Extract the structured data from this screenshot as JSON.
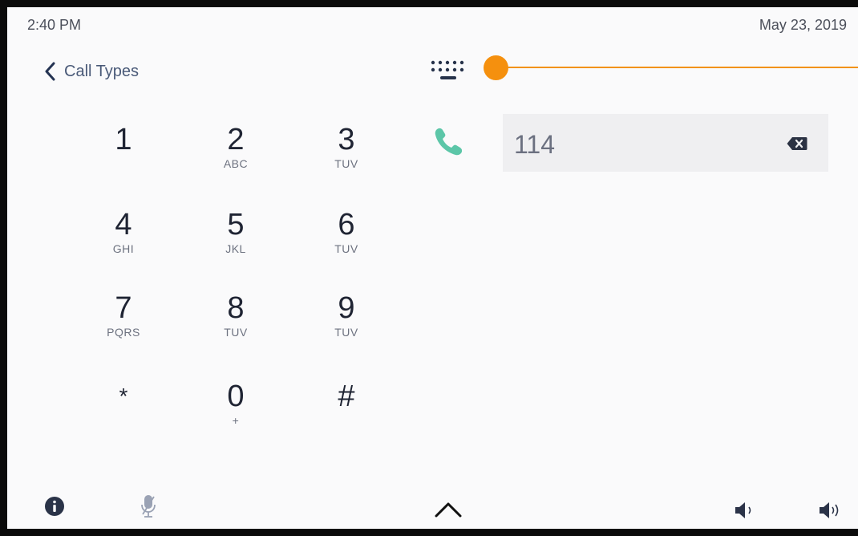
{
  "status": {
    "time": "2:40 PM",
    "date": "May 23, 2019"
  },
  "nav": {
    "back_label": "Call Types"
  },
  "keypad": [
    {
      "digit": "1",
      "letters": ""
    },
    {
      "digit": "2",
      "letters": "ABC"
    },
    {
      "digit": "3",
      "letters": "TUV"
    },
    {
      "digit": "4",
      "letters": "GHI"
    },
    {
      "digit": "5",
      "letters": "JKL"
    },
    {
      "digit": "6",
      "letters": "TUV"
    },
    {
      "digit": "7",
      "letters": "PQRS"
    },
    {
      "digit": "8",
      "letters": "TUV"
    },
    {
      "digit": "9",
      "letters": "TUV"
    },
    {
      "digit": "*",
      "letters": ""
    },
    {
      "digit": "0",
      "letters": "+"
    },
    {
      "digit": "#",
      "letters": ""
    }
  ],
  "dial": {
    "number": "114"
  },
  "slider": {
    "value": 0
  },
  "colors": {
    "accent": "#f5900e",
    "call": "#5cc6a8",
    "text": "#1f2433",
    "field": "#efeff1"
  },
  "icons": [
    "back-chevron-icon",
    "keyboard-icon",
    "phone-icon",
    "backspace-icon",
    "info-icon",
    "microphone-muted-icon",
    "chevron-up-icon",
    "volume-down-icon",
    "volume-up-icon"
  ]
}
